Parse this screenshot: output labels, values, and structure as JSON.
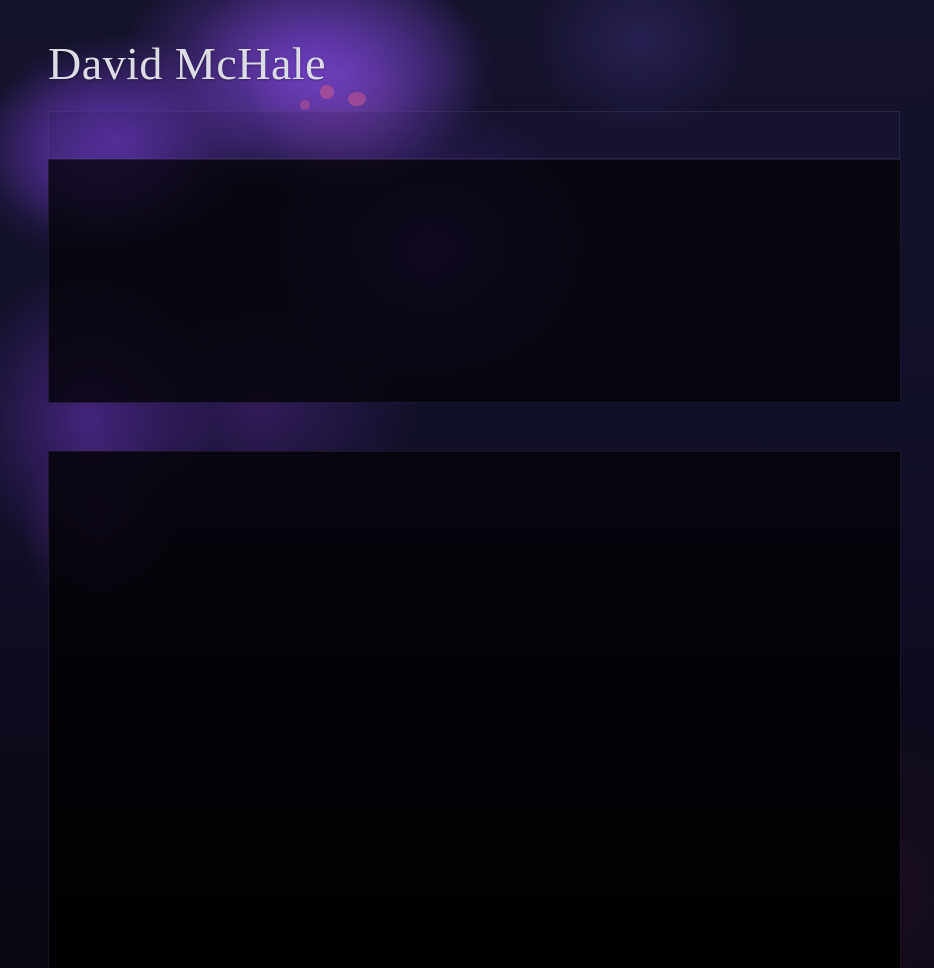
{
  "site": {
    "title": "David McHale"
  },
  "colors": {
    "background": "#111029",
    "accent_purple": "#5c2fa8",
    "title_text": "#dcdce6",
    "panel_fill": "#050308"
  }
}
